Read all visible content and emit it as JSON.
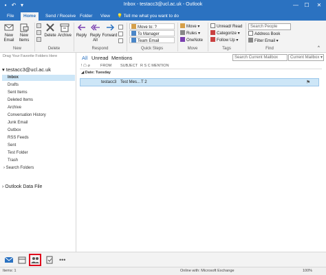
{
  "titlebar": {
    "title": "Inbox - testacc3@ucl.ac.uk  -  Outlook",
    "min_glyph": "—",
    "max_glyph": "☐",
    "close_glyph": "✕"
  },
  "tabs": {
    "file": "File",
    "home": "Home",
    "send_receive": "Send / Receive",
    "folder": "Folder",
    "view": "View",
    "tell_me": "Tell me what you want to do"
  },
  "ribbon": {
    "new_email": "New Email",
    "new_items": "New Items",
    "delete": "Delete",
    "archive": "Archive",
    "reply": "Reply",
    "reply_all": "Reply All",
    "forward": "Forward",
    "move_to": "Move to: ?",
    "to_manager": "To Manager",
    "team_email": "Team Email",
    "move": "Move",
    "rules": "Rules",
    "onenote": "OneNote",
    "unread_read": "Unread/ Read",
    "categorize": "Categorize",
    "follow_up": "Follow Up",
    "search_people_placeholder": "Search People",
    "address_book": "Address Book",
    "filter_email": "Filter Email",
    "groups": {
      "new": "New",
      "delete": "Delete",
      "respond": "Respond",
      "quick_steps": "Quick Steps",
      "move": "Move",
      "tags": "Tags",
      "find": "Find"
    }
  },
  "folderpane": {
    "drag_tip": "Drag Your Favorite Folders Here",
    "account": "testacc3@ucl.ac.uk",
    "folders": [
      "Inbox",
      "Drafts",
      "Sent Items",
      "Deleted Items",
      "Archive",
      "Conversation History",
      "Junk Email",
      "Outbox",
      "RSS Feeds",
      "Sent",
      "Test Folder",
      "Trash",
      "Search Folders"
    ],
    "data_file": "Outlook Data File"
  },
  "msglist": {
    "filters": [
      "All",
      "Unread",
      "Mentions"
    ],
    "search_placeholder": "Search Current Mailbox",
    "scope": "Current Mailbox",
    "columns": [
      "FROM",
      "SUBJECT",
      "R S C  MENTION"
    ],
    "date_group": "Date: Tuesday",
    "messages": [
      {
        "from": "testacc3",
        "subject": "Test Mes...",
        "size": "T 2"
      }
    ]
  },
  "statusbar": {
    "left": "Items: 1",
    "center": "Online with: Microsoft Exchange",
    "zoom": "100%"
  },
  "colors": {
    "brand": "#2b72c1",
    "selection": "#cde6f7",
    "highlight_box": "#e0001a"
  }
}
